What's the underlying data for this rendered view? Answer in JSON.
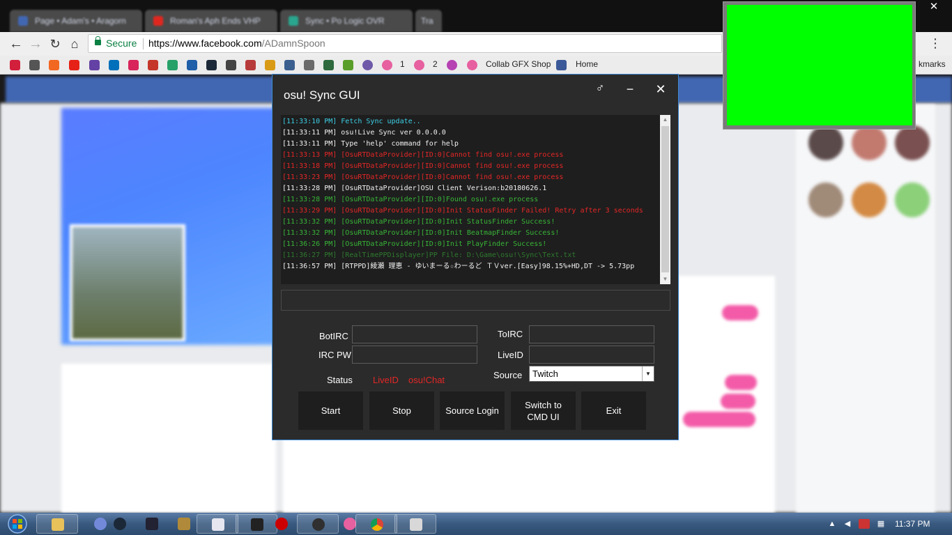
{
  "browser": {
    "tabs": [
      {
        "label": "Page • Adam's • Aragorn",
        "color": "#4267b2"
      },
      {
        "label": "Roman's Aph Ends VHP",
        "color": "#e0271f"
      },
      {
        "label": "Sync • Po Logic OVR",
        "color": "#2aa58e"
      },
      {
        "label": "Tra",
        "color": "#777777"
      }
    ],
    "secure_label": "Secure",
    "url_scheme_host": "https://www.facebook.com",
    "url_path": "/ADamnSpoon",
    "bookmarks": [
      {
        "label": "1"
      },
      {
        "label": "2"
      },
      {
        "label": "Collab GFX Shop"
      },
      {
        "label": "Home"
      }
    ],
    "bookmarks_overflow": "kmarks"
  },
  "window": {
    "title": "osu! Sync GUI",
    "gender_glyph": "♂",
    "minimize_glyph": "−",
    "close_glyph": "✕"
  },
  "log": [
    {
      "text": "[11:33:10 PM] Fetch Sync update..",
      "color": "cyan"
    },
    {
      "text": "[11:33:11 PM] osu!Live Sync ver 0.0.0.0",
      "color": "white"
    },
    {
      "text": "[11:33:11 PM] Type 'help' command for help",
      "color": "white"
    },
    {
      "text": "[11:33:13 PM] [OsuRTDataProvider][ID:0]Cannot find osu!.exe process",
      "color": "red"
    },
    {
      "text": "[11:33:18 PM] [OsuRTDataProvider][ID:0]Cannot find osu!.exe process",
      "color": "red"
    },
    {
      "text": "[11:33:23 PM] [OsuRTDataProvider][ID:0]Cannot find osu!.exe process",
      "color": "red"
    },
    {
      "text": "[11:33:28 PM] [OsuRTDataProvider]OSU Client Verison:b20180626.1",
      "color": "white"
    },
    {
      "text": "[11:33:28 PM] [OsuRTDataProvider][ID:0]Found osu!.exe process",
      "color": "green"
    },
    {
      "text": "[11:33:29 PM] [OsuRTDataProvider][ID:0]Init StatusFinder Failed! Retry after 3 seconds",
      "color": "red"
    },
    {
      "text": "[11:33:32 PM] [OsuRTDataProvider][ID:0]Init StatusFinder Success!",
      "color": "green"
    },
    {
      "text": "[11:33:32 PM] [OsuRTDataProvider][ID:0]Init BeatmapFinder Success!",
      "color": "green"
    },
    {
      "text": "[11:36:26 PM] [OsuRTDataProvider][ID:0]Init PlayFinder Success!",
      "color": "green"
    },
    {
      "text": "[11:36:27 PM] [RealTimePPDisplayer]PP File: D:\\Game\\osu!\\Sync\\Text.txt",
      "color": "faded"
    },
    {
      "text": "[11:36:57 PM] [RTPPD]綾瀬 理恵 - ゆいまーる☆わーるど ＴＶver.[Easy]98.15%+HD,DT -> 5.73pp",
      "color": "white"
    }
  ],
  "form": {
    "bot_irc_label": "BotIRC",
    "irc_pw_label": "IRC PW",
    "to_irc_label": "ToIRC",
    "live_id_label": "LiveID",
    "status_label": "Status",
    "status_live_id": "LiveID",
    "status_osu_chat": "osu!Chat",
    "source_label": "Source",
    "source_value": "Twitch"
  },
  "buttons": {
    "start": "Start",
    "stop": "Stop",
    "source_login": "Source Login",
    "switch_line1": "Switch to",
    "switch_line2": "CMD UI",
    "exit": "Exit"
  },
  "taskbar": {
    "clock": "11:37 PM"
  },
  "colors": {
    "window_bg": "#2b2b2b",
    "window_border": "#3e8bd6",
    "log_cyan": "#3ccfe6",
    "log_red": "#e62626",
    "log_green": "#38b538",
    "preview_green": "#00ff00"
  }
}
